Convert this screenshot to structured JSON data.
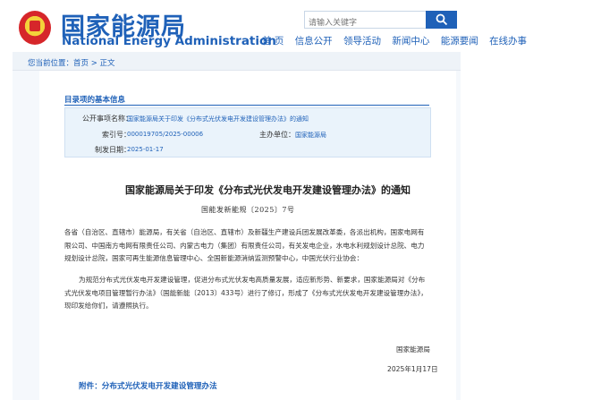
{
  "header": {
    "logo_cn": "国家能源局",
    "logo_en": "National Energy Administration",
    "search_placeholder": "请输入关键字"
  },
  "nav": [
    "首 页",
    "信息公开",
    "领导活动",
    "新闻中心",
    "能源要闻",
    "在线办事"
  ],
  "breadcrumb": "您当前位置：首页 > 正文",
  "basic_info": {
    "title": "目录项的基本信息",
    "public_item_label": "公开事项名称：",
    "public_item_value": "国家能源局关于印发《分布式光伏发电开发建设管理办法》的通知",
    "index_label": "索引号：",
    "index_value": "000019705/2025-00006",
    "owner_label": "主办单位：",
    "owner_value": "国家能源局",
    "date_label": "制发日期：",
    "date_value": "2025-01-17"
  },
  "document": {
    "title": "国家能源局关于印发《分布式光伏发电开发建设管理办法》的通知",
    "number": "国能发新能规〔2025〕7号",
    "para1": "各省（自治区、直辖市）能源局，有关省（自治区、直辖市）及新疆生产建设兵团发展改革委，各派出机构，国家电网有限公司、中国南方电网有限责任公司、内蒙古电力（集团）有限责任公司，有关发电企业，水电水利规划设计总院、电力规划设计总院，国家可再生能源信息管理中心、全国新能源消纳监测预警中心，中国光伏行业协会：",
    "para2": "为规范分布式光伏发电开发建设管理，促进分布式光伏发电高质量发展，适应新形势、新要求，国家能源局对《分布式光伏发电项目管理暂行办法》（国能新能〔2013〕433号）进行了修订，形成了《分布式光伏发电开发建设管理办法》，现印发给你们，请遵照执行。",
    "signature": "国家能源局",
    "sign_date": "2025年1月17日",
    "attachment": "附件：分布式光伏发电开发建设管理办法"
  },
  "colors": {
    "brand_blue": "#1f61b8",
    "emblem_red": "#d6262a",
    "info_bg": "#eaf3fb"
  },
  "icons": [
    "national-emblem-icon",
    "search-icon"
  ]
}
